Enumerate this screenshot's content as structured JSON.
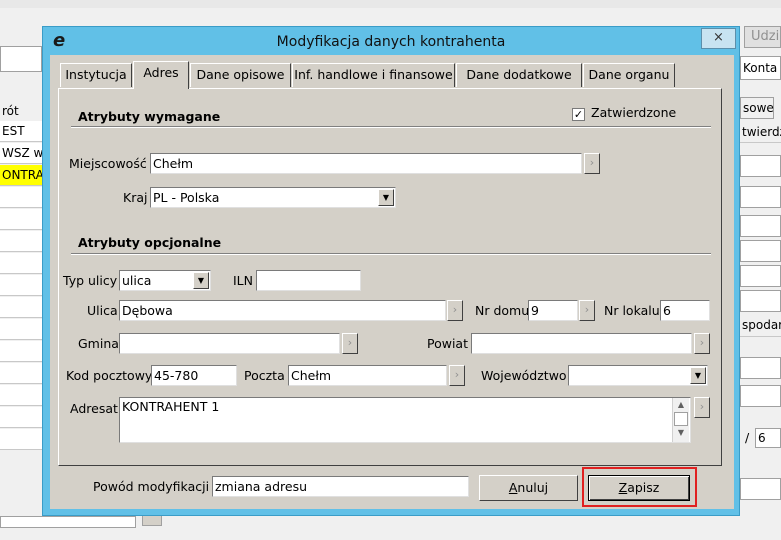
{
  "background": {
    "right_labels": [
      "Udzi",
      "Konta K",
      "sowe",
      "twierdz",
      "spodar",
      "6"
    ],
    "left_rows": [
      "rót",
      "EST",
      "WSZ w",
      "ONTRA"
    ],
    "slash": "/"
  },
  "dialog": {
    "title": "Modyfikacja danych kontrahenta",
    "logo": "e",
    "close": "×",
    "tabs": [
      "Instytucja",
      "Adres",
      "Dane opisowe",
      "Inf. handlowe i finansowe",
      "Dane dodatkowe",
      "Dane organu"
    ],
    "active_tab": "Adres",
    "required": {
      "heading": "Atrybuty wymagane",
      "approved_label": "Zatwierdzone",
      "approved_checked": true,
      "city_label": "Miejscowość",
      "city_value": "Chełm",
      "country_label": "Kraj",
      "country_value": "PL - Polska"
    },
    "optional": {
      "heading": "Atrybuty opcjonalne",
      "street_type_label": "Typ ulicy",
      "street_type_value": "ulica",
      "iln_label": "ILN",
      "iln_value": "",
      "street_label": "Ulica",
      "street_value": "Dębowa",
      "house_label": "Nr domu",
      "house_value": "9",
      "flat_label": "Nr lokalu",
      "flat_value": "6",
      "commune_label": "Gmina",
      "commune_value": "",
      "county_label": "Powiat",
      "county_value": "",
      "postcode_label": "Kod pocztowy",
      "postcode_value": "45-780",
      "post_label": "Poczta",
      "post_value": "Chełm",
      "voivodeship_label": "Województwo",
      "voivodeship_value": "",
      "addressee_label": "Adresat",
      "addressee_value": "KONTRAHENT 1"
    },
    "footer": {
      "reason_label": "Powód modyfikacji",
      "reason_value": "zmiana adresu",
      "cancel_pre": "A",
      "cancel_rest": "nuluj",
      "save_pre": "Z",
      "save_rest": "apisz"
    },
    "accent_red": "#e02020"
  }
}
